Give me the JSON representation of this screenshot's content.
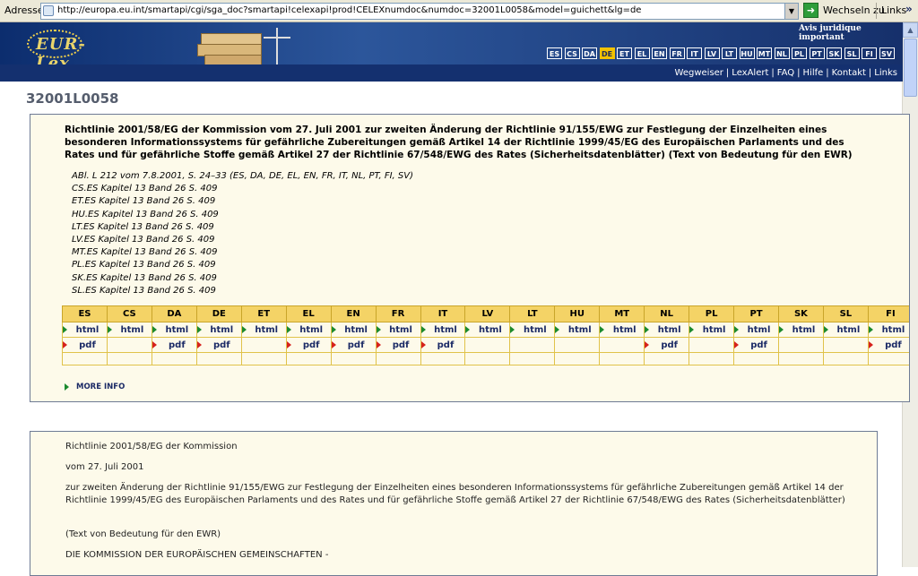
{
  "browser": {
    "address_label": "Adresse",
    "url": "http://europa.eu.int/smartapi/cgi/sga_doc?smartapi!celexapi!prod!CELEXnumdoc&numdoc=32001L0058&model=guichett&lg=de",
    "go_label": "Wechseln zu",
    "links_label": "Links",
    "more_label": "»"
  },
  "header": {
    "logo_text": "EUR-Lex",
    "avis": "Avis juridique important",
    "languages": [
      "ES",
      "CS",
      "DA",
      "DE",
      "ET",
      "EL",
      "EN",
      "FR",
      "IT",
      "LV",
      "LT",
      "HU",
      "MT",
      "NL",
      "PL",
      "PT",
      "SK",
      "SL",
      "FI",
      "SV"
    ],
    "selected_language": "DE",
    "nav_links": [
      "Wegweiser",
      "LexAlert",
      "FAQ",
      "Hilfe",
      "Kontakt",
      "Links"
    ]
  },
  "doc": {
    "celex_number": "32001L0058",
    "title": "Richtlinie 2001/58/EG der Kommission vom 27. Juli 2001 zur zweiten Änderung der Richtlinie 91/155/EWG zur Festlegung der Einzelheiten eines besonderen Informationssystems für gefährliche Zubereitungen gemäß Artikel 14 der Richtlinie 1999/45/EG des Europäischen Parlaments und des Rates und für gefährliche Stoffe gemäß Artikel 27 der Richtlinie 67/548/EWG des Rates (Sicherheitsdatenblätter) (Text von Bedeutung für den EWR)",
    "references": [
      "ABl. L 212 vom 7.8.2001, S. 24–33 (ES, DA, DE, EL, EN, FR, IT, NL, PT, FI, SV)",
      "CS.ES Kapitel 13 Band 26 S. 409",
      "ET.ES Kapitel 13 Band 26 S. 409",
      "HU.ES Kapitel 13 Band 26 S. 409",
      "LT.ES Kapitel 13 Band 26 S. 409",
      "LV.ES Kapitel 13 Band 26 S. 409",
      "MT.ES Kapitel 13 Band 26 S. 409",
      "PL.ES Kapitel 13 Band 26 S. 409",
      "SK.ES Kapitel 13 Band 26 S. 409",
      "SL.ES Kapitel 13 Band 26 S. 409"
    ],
    "format_table": {
      "languages": [
        "ES",
        "CS",
        "DA",
        "DE",
        "ET",
        "EL",
        "EN",
        "FR",
        "IT",
        "LV",
        "LT",
        "HU",
        "MT",
        "NL",
        "PL",
        "PT",
        "SK",
        "SL",
        "FI"
      ],
      "html_label": "html",
      "pdf_label": "pdf",
      "pdf_available": [
        true,
        false,
        true,
        true,
        false,
        true,
        true,
        true,
        true,
        false,
        false,
        false,
        false,
        true,
        false,
        true,
        false,
        false,
        true
      ]
    },
    "more_info": "MORE INFO",
    "body_paragraphs": [
      "Richtlinie 2001/58/EG der Kommission",
      "vom 27. Juli 2001",
      "zur zweiten Änderung der Richtlinie 91/155/EWG zur Festlegung der Einzelheiten eines besonderen Informationssystems für gefährliche Zubereitungen gemäß Artikel 14 der Richtlinie 1999/45/EG des Europäischen Parlaments und des Rates und für gefährliche Stoffe gemäß Artikel 27 der Richtlinie 67/548/EWG des Rates (Sicherheitsdatenblätter)",
      "(Text von Bedeutung für den EWR)",
      "DIE KOMMISSION DER EUROPÄISCHEN GEMEINSCHAFTEN -"
    ]
  },
  "colors": {
    "banner_dark": "#14306f",
    "selected_lang": "#f2c200",
    "panel_bg": "#fdfaea",
    "table_header": "#f4d366"
  }
}
